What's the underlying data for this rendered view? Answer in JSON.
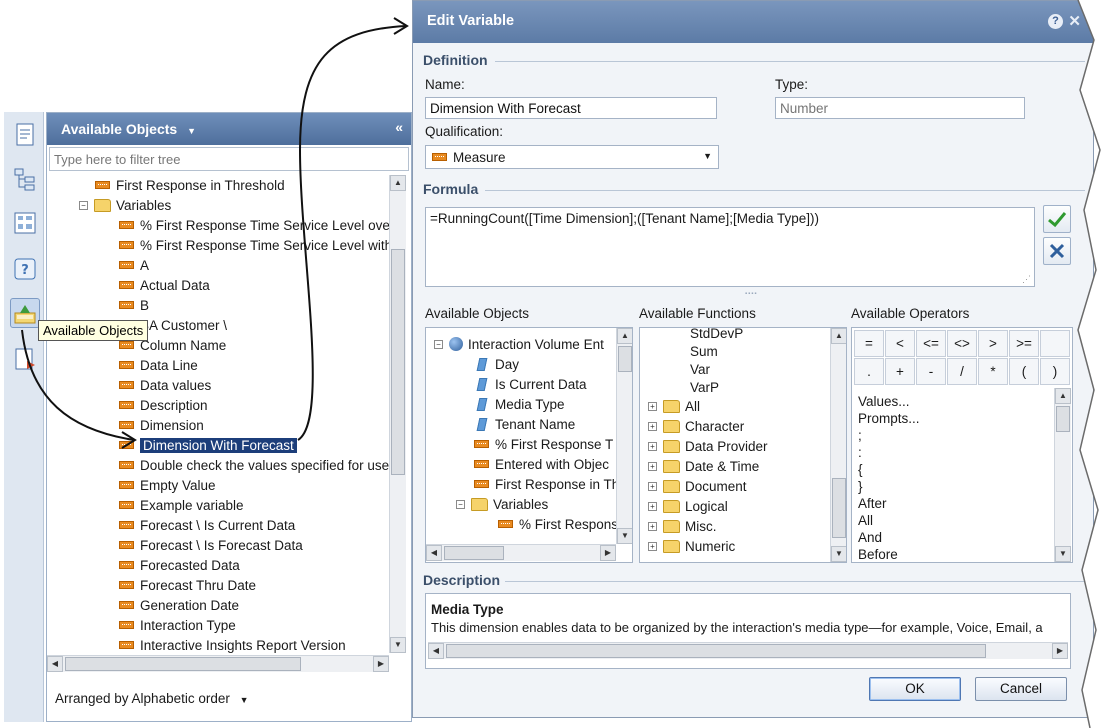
{
  "tooltip": "Available Objects",
  "left_panel": {
    "header": "Available Objects",
    "collapse_glyph": "«",
    "filter_placeholder": "Type here to filter tree",
    "arranged_by": "Arranged by Alphabetic order",
    "tree": [
      {
        "label": "First Response in Threshold",
        "kind": "measure",
        "indent": 1
      },
      {
        "label": "Variables",
        "kind": "folder",
        "indent": 0,
        "expanded": true
      },
      {
        "label": "% First Response Time Service Level ove",
        "kind": "measure",
        "indent": 2
      },
      {
        "label": "% First Response Time Service Level with",
        "kind": "measure",
        "indent": 2
      },
      {
        "label": "A",
        "kind": "measure",
        "indent": 2
      },
      {
        "label": "Actual Data",
        "kind": "measure",
        "indent": 2
      },
      {
        "label": "B",
        "kind": "measure",
        "indent": 2
      },
      {
        "label": "BA Customer \\",
        "kind": "measure",
        "indent": 2
      },
      {
        "label": "Column Name",
        "kind": "measure",
        "indent": 2
      },
      {
        "label": "Data Line",
        "kind": "measure",
        "indent": 2
      },
      {
        "label": "Data values",
        "kind": "measure",
        "indent": 2
      },
      {
        "label": "Description",
        "kind": "measure",
        "indent": 2
      },
      {
        "label": "Dimension",
        "kind": "measure",
        "indent": 2
      },
      {
        "label": "Dimension With Forecast",
        "kind": "measure",
        "indent": 2,
        "selected": true
      },
      {
        "label": "Double check the values specified for use",
        "kind": "measure",
        "indent": 2
      },
      {
        "label": "Empty Value",
        "kind": "measure",
        "indent": 2
      },
      {
        "label": "Example variable",
        "kind": "measure",
        "indent": 2
      },
      {
        "label": "Forecast \\ Is Current Data",
        "kind": "measure",
        "indent": 2
      },
      {
        "label": "Forecast \\ Is Forecast Data",
        "kind": "measure",
        "indent": 2
      },
      {
        "label": "Forecasted Data",
        "kind": "measure",
        "indent": 2
      },
      {
        "label": "Forecast Thru Date",
        "kind": "measure",
        "indent": 2
      },
      {
        "label": "Generation Date",
        "kind": "measure",
        "indent": 2
      },
      {
        "label": "Interaction Type",
        "kind": "measure",
        "indent": 2
      },
      {
        "label": "Interactive Insights Report Version",
        "kind": "measure",
        "indent": 2
      }
    ]
  },
  "dialog": {
    "title": "Edit Variable",
    "help_glyph": "?",
    "close_glyph": "✕",
    "definition_label": "Definition",
    "name_label": "Name:",
    "name_value": "Dimension With Forecast",
    "type_label": "Type:",
    "type_placeholder": "Number",
    "qualification_label": "Qualification:",
    "qualification_value": "Measure",
    "formula_label": "Formula",
    "formula_value": "=RunningCount([Time Dimension];([Tenant Name];[Media Type]))",
    "grip": "▪▪▪▪",
    "available_objects_label": "Available Objects",
    "available_functions_label": "Available Functions",
    "available_operators_label": "Available Operators",
    "objects": [
      {
        "label": "Interaction Volume Ent",
        "kind": "universe",
        "indent": 0
      },
      {
        "label": "Day",
        "kind": "dimension",
        "indent": 1
      },
      {
        "label": "Is Current Data",
        "kind": "dimension",
        "indent": 1
      },
      {
        "label": "Media Type",
        "kind": "dimension",
        "indent": 1
      },
      {
        "label": "Tenant Name",
        "kind": "dimension",
        "indent": 1
      },
      {
        "label": "% First Response T",
        "kind": "measure",
        "indent": 1
      },
      {
        "label": "Entered with Objec",
        "kind": "measure",
        "indent": 1
      },
      {
        "label": "First Response in Th",
        "kind": "measure",
        "indent": 1
      },
      {
        "label": "Variables",
        "kind": "folder",
        "indent": 0.5
      },
      {
        "label": "% First Respons",
        "kind": "measure",
        "indent": 2
      }
    ],
    "functions_top": [
      "StdDevP",
      "Sum",
      "Var",
      "VarP"
    ],
    "function_groups": [
      "All",
      "Character",
      "Data Provider",
      "Date & Time",
      "Document",
      "Logical",
      "Misc.",
      "Numeric"
    ],
    "operators_grid": [
      "=",
      "<",
      "<=",
      "<>",
      ">",
      ">=",
      "",
      ".",
      "+",
      "-",
      "/",
      "*",
      "(",
      ")"
    ],
    "operators_list": [
      "Values...",
      "Prompts...",
      ";",
      ":",
      "{",
      "}",
      "After",
      "All",
      "And",
      "Before"
    ],
    "description_label": "Description",
    "description_title": "Media Type",
    "description_text": "This dimension enables data to be organized by the interaction's media type—for example, Voice, Email, a",
    "ok_label": "OK",
    "cancel_label": "Cancel"
  },
  "colors": {
    "accent": "#5c7ba6",
    "selection": "#1c3e7a",
    "measure_icon": "#e88a20",
    "apply_green": "#2f9a2f",
    "cancel_blue": "#2f5f9c"
  },
  "icons": [
    "report-icon",
    "tree-icon",
    "document-structure-icon",
    "help-icon",
    "available-objects-icon",
    "input-controls-icon",
    "check-icon",
    "close-icon"
  ]
}
